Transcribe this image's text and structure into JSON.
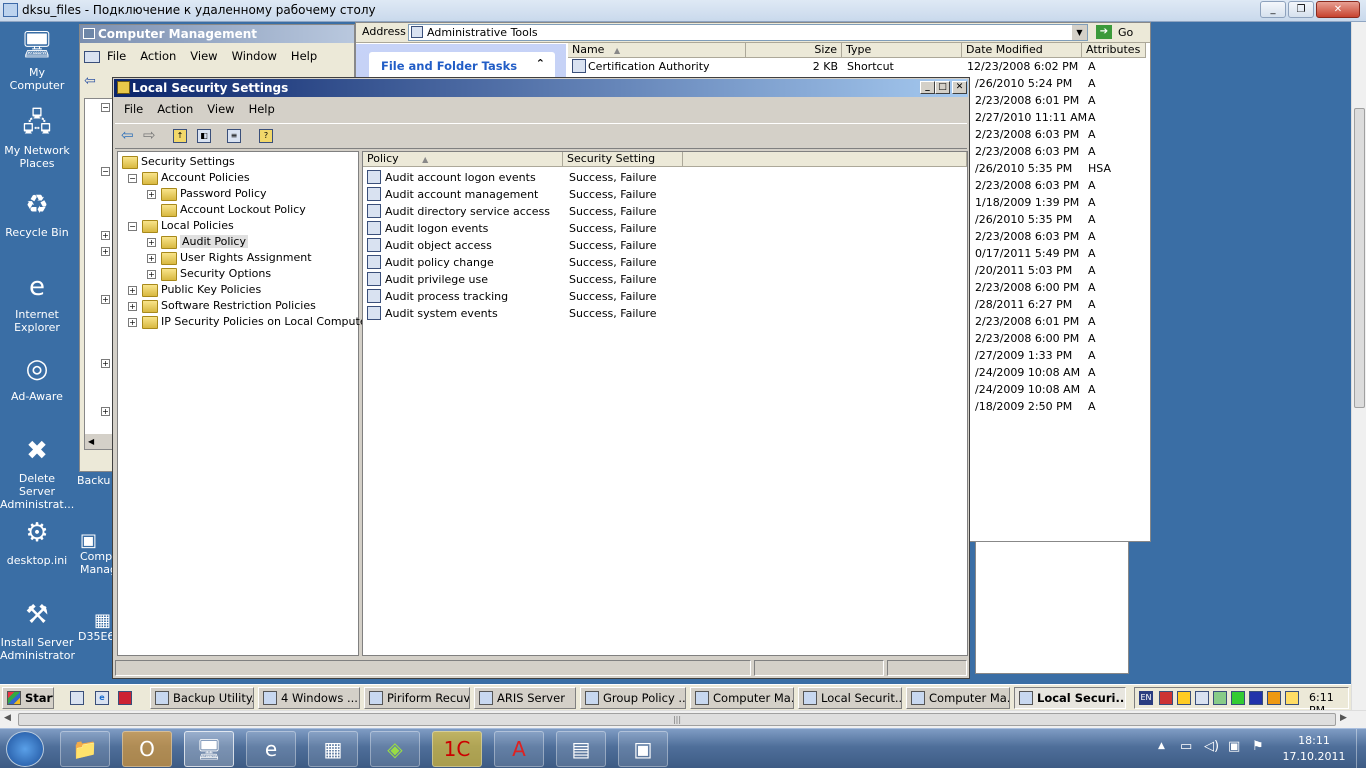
{
  "rdp": {
    "title": "dksu_files - Подключение к удаленному рабочему столу"
  },
  "desktop_icons": [
    {
      "label": "My Computer",
      "glyph": "🖥"
    },
    {
      "label": "My Network Places",
      "glyph": "🖧"
    },
    {
      "label": "Recycle Bin",
      "glyph": "♻"
    },
    {
      "label": "Internet Explorer",
      "glyph": "e"
    },
    {
      "label": "Ad-Aware",
      "glyph": "◎"
    },
    {
      "label": "Delete Server Administrat...",
      "glyph": "✖"
    },
    {
      "label": "desktop.ini",
      "glyph": "⚙"
    },
    {
      "label": "Install Server Administrator",
      "glyph": "⚒"
    }
  ],
  "partial_icons": {
    "backup": "Backu",
    "comp": "Comp Manag",
    "d35": "D35E6"
  },
  "computer_mgmt": {
    "title": "Computer Management",
    "menu": [
      "File",
      "Action",
      "View",
      "Window",
      "Help"
    ]
  },
  "explorer": {
    "address_label": "Address",
    "address_value": "Administrative Tools",
    "go": "Go",
    "task_panel": "File and Folder Tasks",
    "columns": [
      "Name",
      "Size",
      "Type",
      "Date Modified",
      "Attributes"
    ],
    "first_row": {
      "name": "Certification Authority",
      "size": "2 KB",
      "type": "Shortcut",
      "date": "12/23/2008 6:02 PM",
      "attr": "A"
    },
    "rows": [
      {
        "date": "/26/2010 5:24 PM",
        "attr": "A"
      },
      {
        "date": "2/23/2008 6:01 PM",
        "attr": "A"
      },
      {
        "date": "2/27/2010 11:11 AM",
        "attr": "A"
      },
      {
        "date": "2/23/2008 6:03 PM",
        "attr": "A"
      },
      {
        "date": "2/23/2008 6:03 PM",
        "attr": "A"
      },
      {
        "date": "/26/2010 5:35 PM",
        "attr": "HSA"
      },
      {
        "date": "2/23/2008 6:03 PM",
        "attr": "A"
      },
      {
        "date": "1/18/2009 1:39 PM",
        "attr": "A"
      },
      {
        "date": "/26/2010 5:35 PM",
        "attr": "A"
      },
      {
        "date": "2/23/2008 6:03 PM",
        "attr": "A"
      },
      {
        "date": "0/17/2011 5:49 PM",
        "attr": "A"
      },
      {
        "date": "/20/2011 5:03 PM",
        "attr": "A"
      },
      {
        "date": "2/23/2008 6:00 PM",
        "attr": "A"
      },
      {
        "date": "/28/2011 6:27 PM",
        "attr": "A"
      },
      {
        "date": "2/23/2008 6:01 PM",
        "attr": "A"
      },
      {
        "date": "2/23/2008 6:00 PM",
        "attr": "A"
      },
      {
        "date": "/27/2009 1:33 PM",
        "attr": "A"
      },
      {
        "date": "/24/2009 10:08 AM",
        "attr": "A"
      },
      {
        "date": "/24/2009 10:08 AM",
        "attr": "A"
      },
      {
        "date": "/18/2009 2:50 PM",
        "attr": "A"
      }
    ]
  },
  "lss": {
    "title": "Local Security Settings",
    "menu": [
      "File",
      "Action",
      "View",
      "Help"
    ],
    "tree": [
      {
        "label": "Security Settings",
        "level": 0,
        "pm": ""
      },
      {
        "label": "Account Policies",
        "level": 1,
        "pm": "−"
      },
      {
        "label": "Password Policy",
        "level": 2,
        "pm": "+"
      },
      {
        "label": "Account Lockout Policy",
        "level": 2,
        "pm": ""
      },
      {
        "label": "Local Policies",
        "level": 1,
        "pm": "−"
      },
      {
        "label": "Audit Policy",
        "level": 2,
        "pm": "+",
        "selected": true
      },
      {
        "label": "User Rights Assignment",
        "level": 2,
        "pm": "+"
      },
      {
        "label": "Security Options",
        "level": 2,
        "pm": "+"
      },
      {
        "label": "Public Key Policies",
        "level": 1,
        "pm": "+"
      },
      {
        "label": "Software Restriction Policies",
        "level": 1,
        "pm": "+"
      },
      {
        "label": "IP Security Policies on Local Computer",
        "level": 1,
        "pm": "+"
      }
    ],
    "columns": [
      "Policy",
      "Security Setting"
    ],
    "policies": [
      {
        "policy": "Audit account logon events",
        "setting": "Success, Failure"
      },
      {
        "policy": "Audit account management",
        "setting": "Success, Failure"
      },
      {
        "policy": "Audit directory service access",
        "setting": "Success, Failure"
      },
      {
        "policy": "Audit logon events",
        "setting": "Success, Failure"
      },
      {
        "policy": "Audit object access",
        "setting": "Success, Failure"
      },
      {
        "policy": "Audit policy change",
        "setting": "Success, Failure"
      },
      {
        "policy": "Audit privilege use",
        "setting": "Success, Failure"
      },
      {
        "policy": "Audit process tracking",
        "setting": "Success, Failure"
      },
      {
        "policy": "Audit system events",
        "setting": "Success, Failure"
      }
    ]
  },
  "xp_taskbar": {
    "start": "Start",
    "buttons": [
      "Backup Utility...",
      "4 Windows ...",
      "Piriform Recuva",
      "ARIS Server",
      "Group Policy ...",
      "Computer Ma...",
      "Local Securit...",
      "Computer Ma...",
      "Local Securi..."
    ],
    "lang": "EN",
    "time": "6:11 PM"
  },
  "win7": {
    "time": "18:11",
    "date": "17.10.2011"
  }
}
